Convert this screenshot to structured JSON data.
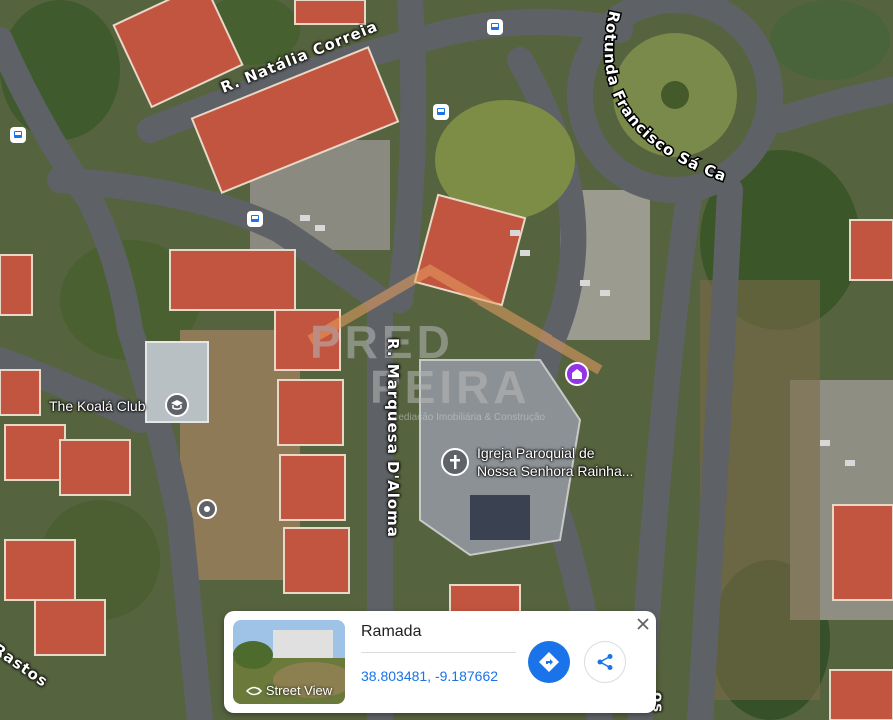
{
  "streets": {
    "natalia": "R. Natália Correia",
    "rotunda": "Rotunda Francisco Sá Carneiro",
    "marquesa": "R. Marquesa D'Aloma",
    "rastos": "Rastos",
    "partial_bottom": "os"
  },
  "pois": {
    "koala": "The Koalá Club",
    "church_line1": "Igreja Paroquial de",
    "church_line2": "Nossa Senhora Rainha..."
  },
  "watermark": {
    "line1": "PRED",
    "line2": "PEIRA",
    "tagline": "Mediação Imobiliária & Construção"
  },
  "place_card": {
    "title": "Ramada",
    "coordinates": "38.803481, -9.187662",
    "street_view_label": "Street View",
    "directions_icon": "directions-icon",
    "share_icon": "share-icon",
    "close_icon": "close-icon"
  },
  "colors": {
    "accent": "#1a73e8",
    "church_pin": "#9334e6",
    "poi_pin": "#5f6368"
  }
}
